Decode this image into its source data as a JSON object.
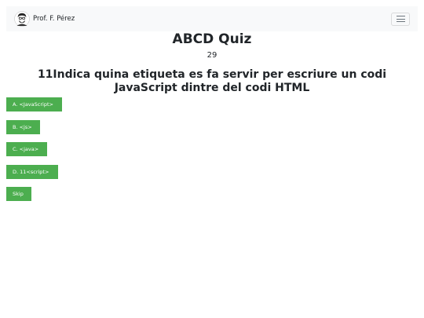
{
  "navbar": {
    "brand_text": "Prof. F. Pérez",
    "logo_icon": "professor-avatar-icon",
    "toggler_icon": "hamburger-menu-icon"
  },
  "quiz": {
    "title": "ABCD Quiz",
    "counter": "29",
    "question": "11Indica quina etiqueta es fa servir per escriure un codi JavaScript dintre del codi HTML"
  },
  "answers": [
    {
      "label": "A. <JavaScript>"
    },
    {
      "label": "B. <js>"
    },
    {
      "label": "C. <java>"
    },
    {
      "label": "D. 11<script>"
    }
  ],
  "skip_label": "Skip",
  "colors": {
    "navbar_bg": "#f8f9fa",
    "button_green": "#4cae4f",
    "text": "#212529"
  }
}
